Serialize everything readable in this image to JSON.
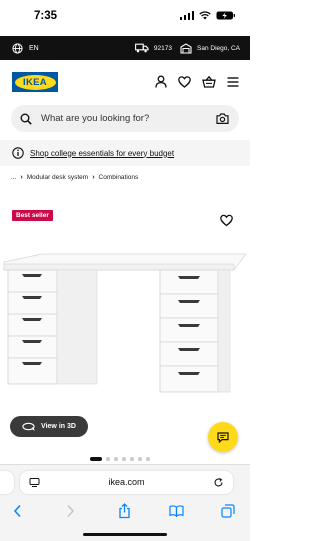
{
  "status_bar": {
    "time": "7:35"
  },
  "utility_bar": {
    "language": "EN",
    "zip": "92173",
    "store": "San Diego, CA"
  },
  "header": {
    "logo_text": "IKEA"
  },
  "search": {
    "placeholder": "What are you looking for?"
  },
  "promo": {
    "link_text": "Shop college essentials for every budget"
  },
  "breadcrumb": {
    "ellipsis": "...",
    "items": [
      "Modular desk system",
      "Combinations"
    ]
  },
  "product": {
    "badge": "Best seller",
    "view_3d_label": "View in 3D",
    "gallery_count": 7,
    "gallery_active_index": 0
  },
  "browser": {
    "url": "ikea.com"
  },
  "colors": {
    "ikea_blue": "#0058a3",
    "ikea_yellow": "#ffda1a",
    "badge_red": "#cc0a49",
    "ios_blue": "#0a84ff"
  },
  "icons": [
    "globe-icon",
    "truck-icon",
    "store-icon",
    "user-icon",
    "heart-icon",
    "cart-icon",
    "menu-icon",
    "search-icon",
    "camera-icon",
    "info-icon",
    "rotate-3d-icon",
    "chat-icon",
    "tabs-icon",
    "reload-icon",
    "back-icon",
    "forward-icon",
    "share-icon",
    "bookmarks-icon",
    "all-tabs-icon"
  ]
}
